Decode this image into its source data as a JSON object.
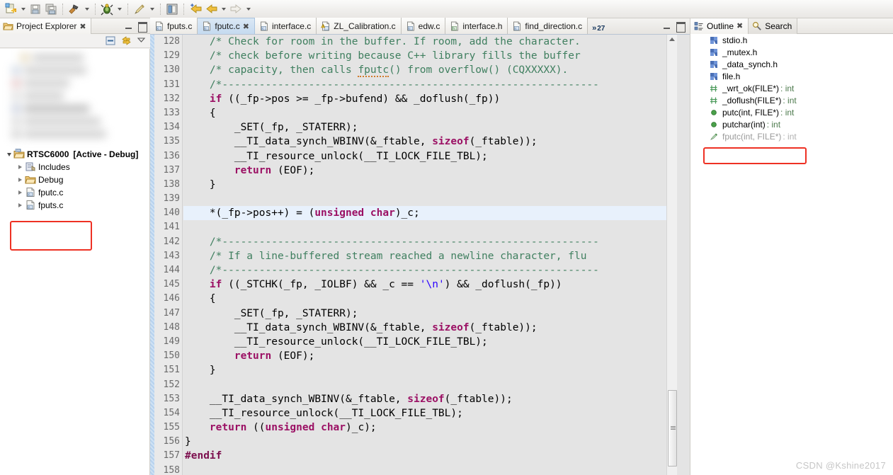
{
  "toolbar": {
    "groups": [
      {
        "buttons": [
          {
            "name": "new-file-button",
            "icon": "new-file-icon",
            "has_dropdown": true
          },
          {
            "name": "save-button",
            "icon": "save-icon",
            "has_dropdown": false
          },
          {
            "name": "save-all-button",
            "icon": "save-all-icon",
            "has_dropdown": false
          }
        ]
      },
      {
        "buttons": [
          {
            "name": "build-button",
            "icon": "hammer-icon",
            "has_dropdown": true
          }
        ]
      },
      {
        "buttons": [
          {
            "name": "debug-button",
            "icon": "bug-icon",
            "has_dropdown": true
          }
        ]
      },
      {
        "buttons": [
          {
            "name": "marker-button",
            "icon": "pen-icon",
            "has_dropdown": true
          }
        ]
      },
      {
        "buttons": [
          {
            "name": "perspective-button",
            "icon": "perspective-icon",
            "has_dropdown": false
          }
        ]
      },
      {
        "buttons": [
          {
            "name": "back-to-last-edit-button",
            "icon": "back-star-arrow-icon",
            "has_dropdown": false
          },
          {
            "name": "navigate-back-button",
            "icon": "back-arrow-icon",
            "has_dropdown": true
          },
          {
            "name": "navigate-forward-button",
            "icon": "forward-arrow-icon",
            "has_dropdown": true
          }
        ]
      }
    ]
  },
  "project_explorer": {
    "tab_label": "Project Explorer",
    "close_glyph": "✖",
    "blurred_items_count": 7,
    "tree": [
      {
        "label": "RTSC6000",
        "suffix": "[Active - Debug]",
        "icon": "ccs-project-icon",
        "indent": 0,
        "expanded": true,
        "bold": true
      },
      {
        "label": "Includes",
        "suffix": "",
        "icon": "includes-icon",
        "indent": 1,
        "expanded": false,
        "bold": false
      },
      {
        "label": "Debug",
        "suffix": "",
        "icon": "folder-icon",
        "indent": 1,
        "expanded": false,
        "bold": false
      },
      {
        "label": "fputc.c",
        "suffix": "",
        "icon": "c-source-icon",
        "indent": 1,
        "expanded": false,
        "bold": false
      },
      {
        "label": "fputs.c",
        "suffix": "",
        "icon": "c-source-icon",
        "indent": 1,
        "expanded": false,
        "bold": false
      }
    ],
    "highlight_color": "#ee3124"
  },
  "editor": {
    "tabs": [
      {
        "label": "fputs.c",
        "icon": "c-file-icon",
        "active": false,
        "closable": false
      },
      {
        "label": "fputc.c",
        "icon": "c-file-icon",
        "active": true,
        "closable": true
      },
      {
        "label": "interface.c",
        "icon": "c-file-icon",
        "active": false,
        "closable": false
      },
      {
        "label": "ZL_Calibration.c",
        "icon": "c-file-warning-icon",
        "active": false,
        "closable": false
      },
      {
        "label": "edw.c",
        "icon": "c-file-icon",
        "active": false,
        "closable": false
      },
      {
        "label": "interface.h",
        "icon": "h-file-icon",
        "active": false,
        "closable": false
      },
      {
        "label": "find_direction.c",
        "icon": "c-file-icon",
        "active": false,
        "closable": false
      }
    ],
    "close_glyph": "✖",
    "overflow_chevron": "»",
    "overflow_count": "27",
    "first_visible_line": 128,
    "highlighted_line": 140,
    "lines": [
      {
        "n": 128,
        "clipped_top": true,
        "tokens": [
          {
            "t": "comment",
            "v": "    /* Check for room in the buffer. If room, add the character."
          }
        ]
      },
      {
        "n": 129,
        "tokens": [
          {
            "t": "comment",
            "v": "    /* check before writing because C++ library fills the buffer"
          }
        ]
      },
      {
        "n": 130,
        "tokens": [
          {
            "t": "comment",
            "v": "    /* capacity, then calls "
          },
          {
            "t": "comment-squiggle",
            "v": "fputc"
          },
          {
            "t": "comment",
            "v": "() from overflow() (CQXXXXX)."
          }
        ]
      },
      {
        "n": 131,
        "tokens": [
          {
            "t": "comment",
            "v": "    /*-------------------------------------------------------------"
          }
        ]
      },
      {
        "n": 132,
        "tokens": [
          {
            "t": "keyword",
            "v": "    if"
          },
          {
            "t": "plain",
            "v": " ((_fp->pos >= _fp->bufend) && _doflush(_fp))"
          }
        ]
      },
      {
        "n": 133,
        "tokens": [
          {
            "t": "plain",
            "v": "    {"
          }
        ]
      },
      {
        "n": 134,
        "tokens": [
          {
            "t": "plain",
            "v": "        _SET(_fp, _STATERR);"
          }
        ]
      },
      {
        "n": 135,
        "tokens": [
          {
            "t": "plain",
            "v": "        __TI_data_synch_WBINV(&_ftable, "
          },
          {
            "t": "keyword",
            "v": "sizeof"
          },
          {
            "t": "plain",
            "v": "(_ftable));"
          }
        ]
      },
      {
        "n": 136,
        "tokens": [
          {
            "t": "plain",
            "v": "        __TI_resource_unlock(__TI_LOCK_FILE_TBL);"
          }
        ]
      },
      {
        "n": 137,
        "tokens": [
          {
            "t": "keyword",
            "v": "        return"
          },
          {
            "t": "plain",
            "v": " (EOF);"
          }
        ]
      },
      {
        "n": 138,
        "tokens": [
          {
            "t": "plain",
            "v": "    }"
          }
        ]
      },
      {
        "n": 139,
        "tokens": [
          {
            "t": "plain",
            "v": ""
          }
        ]
      },
      {
        "n": 140,
        "highlight": true,
        "tokens": [
          {
            "t": "plain",
            "v": "    *(_fp->pos++) = ("
          },
          {
            "t": "keyword",
            "v": "unsigned char"
          },
          {
            "t": "plain",
            "v": ")_c;"
          }
        ]
      },
      {
        "n": 141,
        "tokens": [
          {
            "t": "plain",
            "v": ""
          }
        ]
      },
      {
        "n": 142,
        "tokens": [
          {
            "t": "comment",
            "v": "    /*-------------------------------------------------------------"
          }
        ]
      },
      {
        "n": 143,
        "tokens": [
          {
            "t": "comment",
            "v": "    /* If a line-buffered stream reached a newline character, flu"
          }
        ]
      },
      {
        "n": 144,
        "tokens": [
          {
            "t": "comment",
            "v": "    /*-------------------------------------------------------------"
          }
        ]
      },
      {
        "n": 145,
        "tokens": [
          {
            "t": "keyword",
            "v": "    if"
          },
          {
            "t": "plain",
            "v": " ((_STCHK(_fp, _IOLBF) && _c == "
          },
          {
            "t": "string",
            "v": "'\\n'"
          },
          {
            "t": "plain",
            "v": ") && _doflush(_fp))"
          }
        ]
      },
      {
        "n": 146,
        "tokens": [
          {
            "t": "plain",
            "v": "    {"
          }
        ]
      },
      {
        "n": 147,
        "tokens": [
          {
            "t": "plain",
            "v": "        _SET(_fp, _STATERR);"
          }
        ]
      },
      {
        "n": 148,
        "tokens": [
          {
            "t": "plain",
            "v": "        __TI_data_synch_WBINV(&_ftable, "
          },
          {
            "t": "keyword",
            "v": "sizeof"
          },
          {
            "t": "plain",
            "v": "(_ftable));"
          }
        ]
      },
      {
        "n": 149,
        "tokens": [
          {
            "t": "plain",
            "v": "        __TI_resource_unlock(__TI_LOCK_FILE_TBL);"
          }
        ]
      },
      {
        "n": 150,
        "tokens": [
          {
            "t": "keyword",
            "v": "        return"
          },
          {
            "t": "plain",
            "v": " (EOF);"
          }
        ]
      },
      {
        "n": 151,
        "tokens": [
          {
            "t": "plain",
            "v": "    }"
          }
        ]
      },
      {
        "n": 152,
        "tokens": [
          {
            "t": "plain",
            "v": ""
          }
        ]
      },
      {
        "n": 153,
        "tokens": [
          {
            "t": "plain",
            "v": "    __TI_data_synch_WBINV(&_ftable, "
          },
          {
            "t": "keyword",
            "v": "sizeof"
          },
          {
            "t": "plain",
            "v": "(_ftable));"
          }
        ]
      },
      {
        "n": 154,
        "tokens": [
          {
            "t": "plain",
            "v": "    __TI_resource_unlock(__TI_LOCK_FILE_TBL);"
          }
        ]
      },
      {
        "n": 155,
        "tokens": [
          {
            "t": "keyword",
            "v": "    return"
          },
          {
            "t": "plain",
            "v": " (("
          },
          {
            "t": "keyword",
            "v": "unsigned char"
          },
          {
            "t": "plain",
            "v": ")_c);"
          }
        ]
      },
      {
        "n": 156,
        "tokens": [
          {
            "t": "plain",
            "v": "}"
          }
        ]
      },
      {
        "n": 157,
        "tokens": [
          {
            "t": "preprocessor",
            "v": "#endif"
          }
        ]
      },
      {
        "n": 158,
        "clipped_bottom": true,
        "tokens": [
          {
            "t": "plain",
            "v": ""
          }
        ]
      }
    ]
  },
  "outline": {
    "tabs": [
      {
        "label": "Outline",
        "icon": "outline-icon",
        "active": true,
        "closable": true
      },
      {
        "label": "Search",
        "icon": "search-icon",
        "active": false,
        "closable": false
      }
    ],
    "close_glyph": "✖",
    "items": [
      {
        "name": "stdio.h",
        "type": "",
        "icon": "include-icon",
        "dim": false
      },
      {
        "name": "_mutex.h",
        "type": "",
        "icon": "include-icon",
        "dim": false
      },
      {
        "name": "_data_synch.h",
        "type": "",
        "icon": "include-icon",
        "dim": false
      },
      {
        "name": "file.h",
        "type": "",
        "icon": "include-icon",
        "dim": false
      },
      {
        "name": "_wrt_ok(FILE*)",
        "type": " : int",
        "icon": "declaration-icon",
        "dim": false
      },
      {
        "name": "_doflush(FILE*)",
        "type": " : int",
        "icon": "declaration-icon",
        "dim": false
      },
      {
        "name": "putc(int, FILE*)",
        "type": " : int",
        "icon": "function-icon",
        "dim": false
      },
      {
        "name": "putchar(int)",
        "type": " : int",
        "icon": "function-icon",
        "dim": false
      },
      {
        "name": "fputc(int, FILE*)",
        "type": " : int",
        "icon": "macro-icon",
        "dim": true
      }
    ],
    "highlight_color": "#ee3124"
  },
  "watermark": {
    "text": "CSDN @Kshine2017"
  }
}
